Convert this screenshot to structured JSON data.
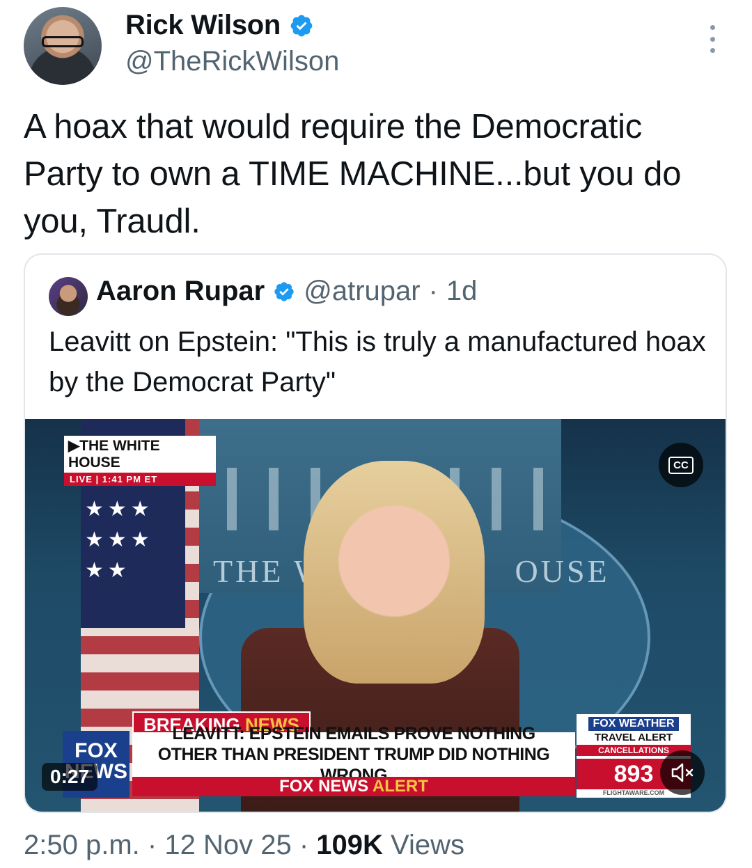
{
  "author": {
    "name": "Rick Wilson",
    "handle": "@TheRickWilson"
  },
  "tweet": {
    "text": "A hoax that would require the Democratic\nParty to own a TIME MACHINE...but you do\nyou, Traudl."
  },
  "quoted": {
    "name": "Aaron Rupar",
    "handle": "@atrupar",
    "separator": "·",
    "age": "1d",
    "text": "Leavitt on Epstein: \"This is truly a manufactured hoax by the Democrat Party\""
  },
  "video": {
    "bug_title": "THE WHITE HOUSE",
    "bug_live": "LIVE",
    "bug_time": "1:41 PM ET",
    "cc_label": "CC",
    "seal_left": "THE W",
    "seal_right": "OUSE",
    "breaking_white": "BREAKING",
    "breaking_gold": "NEWS",
    "headline_1": "LEAVITT: EPSTEIN EMAILS PROVE NOTHING",
    "headline_2": "OTHER THAN PRESIDENT TRUMP DID NOTHING WRONG",
    "alert_white": "FOX NEWS",
    "alert_gold": "ALERT",
    "fox_logo_1": "FOX",
    "fox_logo_2": "NEWS",
    "weather_brand": "FOX WEATHER",
    "weather_title": "TRAVEL ALERT",
    "weather_sub": "CANCELLATIONS",
    "weather_count": "893",
    "weather_source": "FLIGHTAWARE.COM",
    "elapsed": "0:27"
  },
  "meta": {
    "time": "2:50 p.m.",
    "dot1": "·",
    "date": "12 Nov 25",
    "dot2": "·",
    "views_count": "109K",
    "views_label": "Views"
  },
  "colors": {
    "verified": "#1d9bf0",
    "secondary_text": "#536471",
    "fox_red": "#c8102e"
  },
  "icons": [
    "verified-badge-icon",
    "more-options-icon",
    "cc-icon",
    "mute-icon"
  ]
}
